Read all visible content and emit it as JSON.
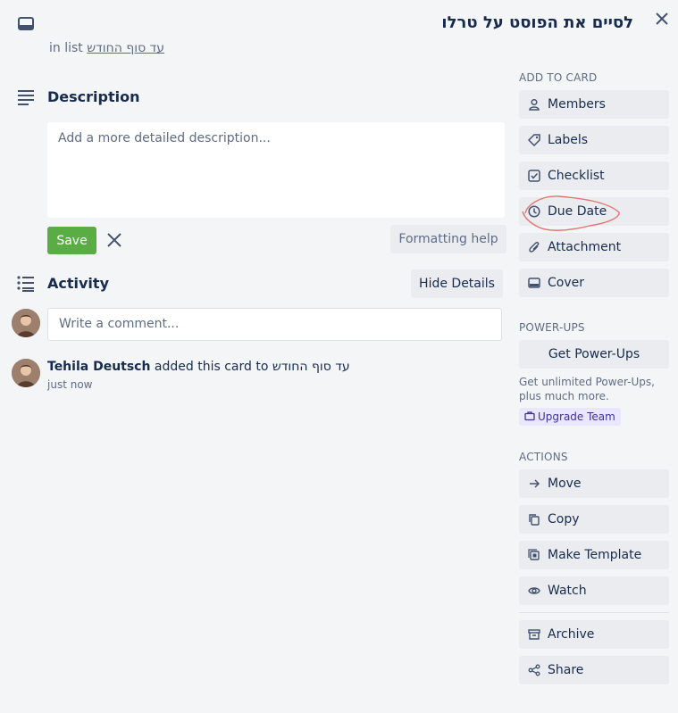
{
  "card": {
    "title": "לסיים את הפוסט על טרלו",
    "in_list_prefix": "in list",
    "list_name": "עד סוף החודש"
  },
  "description": {
    "heading": "Description",
    "placeholder": "Add a more detailed description...",
    "save_label": "Save",
    "formatting_label": "Formatting help"
  },
  "activity": {
    "heading": "Activity",
    "hide_details_label": "Hide Details",
    "comment_placeholder": "Write a comment...",
    "entry": {
      "user": "Tehila Deutsch",
      "action": "added this card to",
      "list": "עד סוף החודש",
      "time": "just now"
    }
  },
  "sidebar": {
    "add_to_card": {
      "heading": "Add to card",
      "items": [
        "Members",
        "Labels",
        "Checklist",
        "Due Date",
        "Attachment",
        "Cover"
      ]
    },
    "power_ups": {
      "heading": "Power-Ups",
      "button": "Get Power-Ups",
      "upsell": "Get unlimited Power-Ups, plus much more.",
      "upgrade": "Upgrade Team"
    },
    "actions": {
      "heading": "Actions",
      "items": [
        "Move",
        "Copy",
        "Make Template",
        "Watch",
        "Archive",
        "Share"
      ]
    }
  },
  "colors": {
    "save_green": "#5aac44",
    "annotation_red": "#e2766f",
    "upgrade_bg": "#eae6ff"
  }
}
